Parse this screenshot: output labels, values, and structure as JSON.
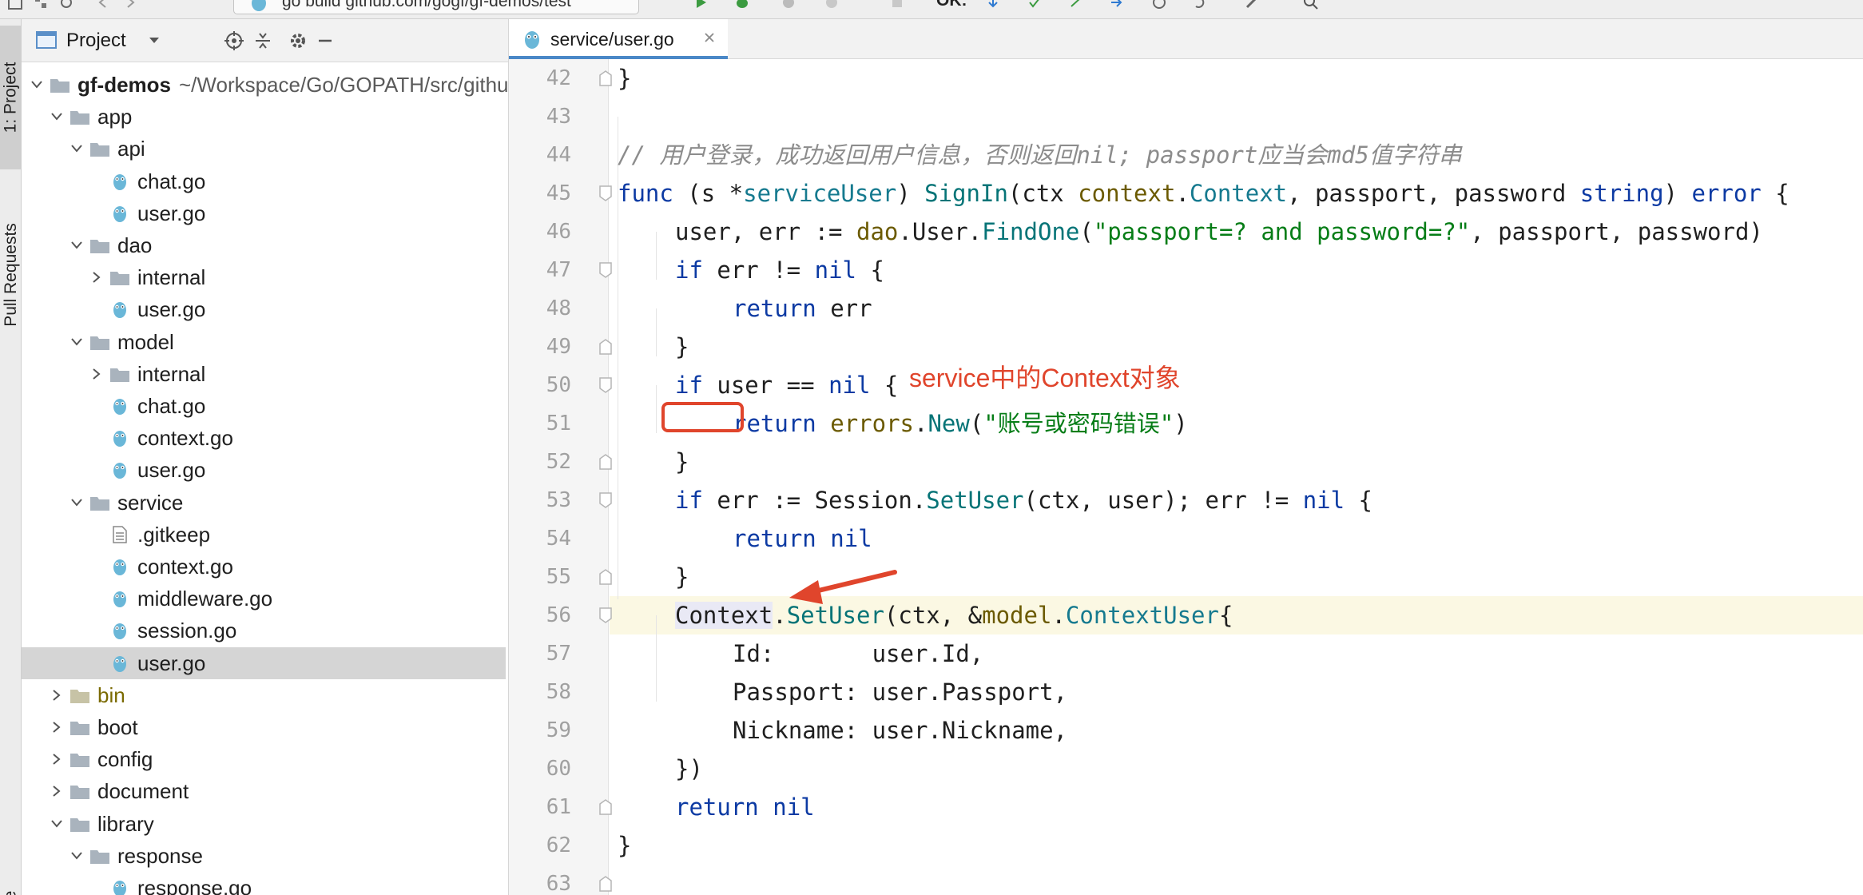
{
  "toolbar": {
    "run_config": "go build github.com/gogf/gf-demos/test",
    "config_label": "OK:"
  },
  "side_strip": {
    "project_label": "1: Project",
    "pull_requests_label": "Pull Requests",
    "bottom_label": "re"
  },
  "project_panel": {
    "title": "Project",
    "tree": [
      {
        "label": "gf-demos",
        "path": "~/Workspace/Go/GOPATH/src/github.com/gogf/gf-demos",
        "type": "folder",
        "expanded": true
      },
      {
        "label": "app",
        "type": "folder",
        "expanded": true
      },
      {
        "label": "api",
        "type": "folder",
        "expanded": true
      },
      {
        "label": "chat.go",
        "type": "go"
      },
      {
        "label": "user.go",
        "type": "go"
      },
      {
        "label": "dao",
        "type": "folder",
        "expanded": true
      },
      {
        "label": "internal",
        "type": "folder",
        "expanded": false
      },
      {
        "label": "user.go",
        "type": "go"
      },
      {
        "label": "model",
        "type": "folder",
        "expanded": true
      },
      {
        "label": "internal",
        "type": "folder",
        "expanded": false
      },
      {
        "label": "chat.go",
        "type": "go"
      },
      {
        "label": "context.go",
        "type": "go"
      },
      {
        "label": "user.go",
        "type": "go"
      },
      {
        "label": "service",
        "type": "folder",
        "expanded": true
      },
      {
        "label": ".gitkeep",
        "type": "file"
      },
      {
        "label": "context.go",
        "type": "go"
      },
      {
        "label": "middleware.go",
        "type": "go"
      },
      {
        "label": "session.go",
        "type": "go"
      },
      {
        "label": "user.go",
        "type": "go",
        "selected": true
      },
      {
        "label": "bin",
        "type": "folder",
        "expanded": false,
        "excluded": true
      },
      {
        "label": "boot",
        "type": "folder",
        "expanded": false
      },
      {
        "label": "config",
        "type": "folder",
        "expanded": false
      },
      {
        "label": "document",
        "type": "folder",
        "expanded": false
      },
      {
        "label": "library",
        "type": "folder",
        "expanded": true
      },
      {
        "label": "response",
        "type": "folder",
        "expanded": true
      },
      {
        "label": "response.go",
        "type": "go"
      }
    ]
  },
  "editor": {
    "tab_title": "service/user.go",
    "line_numbers": [
      "42",
      "43",
      "44",
      "45",
      "46",
      "47",
      "48",
      "49",
      "50",
      "51",
      "52",
      "53",
      "54",
      "55",
      "56",
      "57",
      "58",
      "59",
      "60",
      "61",
      "62",
      "63"
    ],
    "current_line": "56",
    "annotation": "service中的Context对象",
    "code": {
      "l42": "}",
      "l44_comment": "// 用户登录，成功返回用户信息，否则返回nil; passport应当会md5值字符串",
      "l45": [
        "func",
        " (s *",
        "serviceUser",
        ") ",
        "SignIn",
        "(ctx ",
        "context",
        ".",
        "Context",
        ", passport, password ",
        "string",
        ") ",
        "error",
        " {"
      ],
      "l46": [
        "user, err := ",
        "dao",
        ".User.",
        "FindOne",
        "(",
        "\"passport=? and password=?\"",
        ", passport, password)"
      ],
      "l47": [
        "if",
        " err != ",
        "nil",
        " {"
      ],
      "l48": [
        "return",
        " err"
      ],
      "l49": "}",
      "l50": [
        "if",
        " user == ",
        "nil",
        " {"
      ],
      "l51": [
        "return",
        " ",
        "errors",
        ".",
        "New",
        "(",
        "\"账号或密码错误\"",
        ")"
      ],
      "l52": "}",
      "l53": [
        "if",
        " err := Session.",
        "SetUser",
        "(ctx, user); err != ",
        "nil",
        " {"
      ],
      "l54": [
        "return",
        " ",
        "nil"
      ],
      "l55": "}",
      "l56": [
        "Context",
        ".",
        "SetUser",
        "(ctx, &",
        "model",
        ".",
        "ContextUser",
        "{"
      ],
      "l57": "Id:       user.Id,",
      "l58": "Passport: user.Passport,",
      "l59": "Nickname: user.Nickname,",
      "l60": "})",
      "l61": [
        "return",
        " ",
        "nil"
      ],
      "l62": "}"
    }
  },
  "colors": {
    "keyword": "#0c3aa3",
    "function": "#067477",
    "string": "#067d17",
    "package": "#6b5a00",
    "comment": "#8c8c8c",
    "annotation": "#e0452c",
    "selection": "#d5d5d5",
    "tab_underline": "#4a88c7"
  }
}
